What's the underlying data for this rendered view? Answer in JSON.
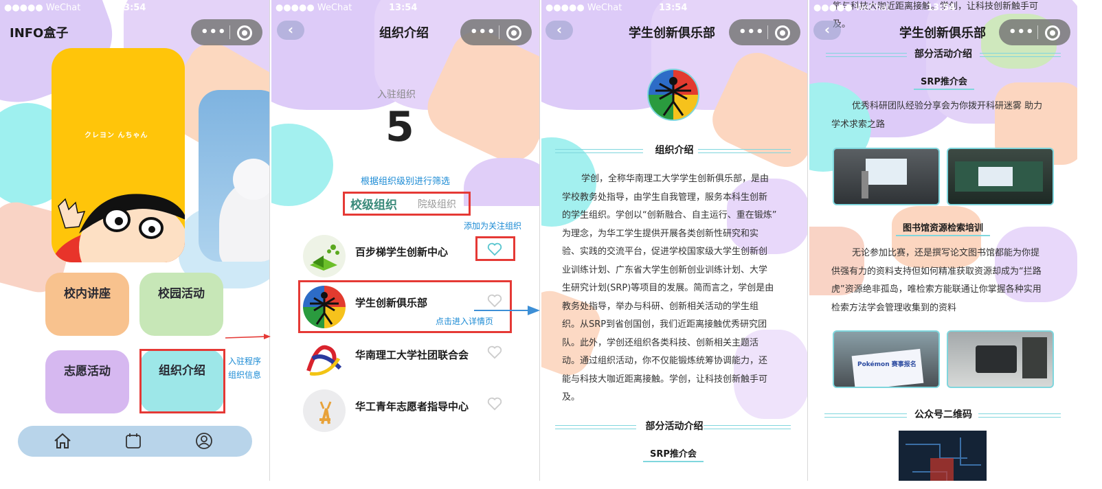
{
  "status": {
    "signal": "●●●●● WeChat",
    "time": "13:54"
  },
  "capsule": {
    "dots": "•••"
  },
  "screen1": {
    "title": "INFO盒子",
    "banner_text": "クレヨン  んちゃん",
    "tiles": [
      "校内讲座",
      "校园活动",
      "志愿活动",
      "组织介绍"
    ],
    "annotation": "入驻程序\n组织信息"
  },
  "screen2": {
    "title": "组织介绍",
    "count_label": "入驻组织",
    "count": "5",
    "filter_hint": "根据组织级别进行筛选",
    "tab_active": "校级组织",
    "tab_inactive": "院级组织",
    "follow_hint": "添加为关注组织",
    "detail_hint": "点击进入详情页",
    "orgs": [
      "百步梯学生创新中心",
      "学生创新俱乐部",
      "华南理工大学社团联合会",
      "华工青年志愿者指导中心"
    ]
  },
  "screen3": {
    "title": "学生创新俱乐部",
    "section_intro": "组织介绍",
    "intro_lines": [
      "学创，全称华南理工大学学生创新俱乐部，是由",
      "学校教务处指导，由学生自我管理，服务本科生创新",
      "的学生组织。学创以“创新融合、自主运行、重在锻炼”",
      "为理念，为华工学生提供开展各类创新性研究和实",
      "验、实践的交流平台，促进学校国家级大学生创新创",
      "业训练计划、广东省大学生创新创业训练计划、大学",
      "生研究计划(SRP)等项目的发展。简而言之，学创是由",
      "教务处指导，举办与科研、创新相关活动的学生组",
      "织。从SRP到省创国创，我们近距离接触优秀研究团",
      "队。此外，学创还组织各类科技、创新相关主题活",
      "动。通过组织活动，你不仅能锻炼统筹协调能力，还",
      "能与科技大咖近距离接触。学创，让科技创新触手可",
      "及。"
    ],
    "section_activities": "部分活动介绍",
    "activity1_title": "SRP推介会"
  },
  "screen4": {
    "title": "学生创新俱乐部",
    "top_line1": "能与科技大咖近距离接触。学创，让科技创新触手可",
    "top_line2": "及。",
    "section_activities": "部分活动介绍",
    "activity1_title": "SRP推介会",
    "activity1_desc1": "优秀科研团队经验分享会为你拨开科研迷雾 助力",
    "activity1_desc2": "学术求索之路",
    "activity2_title": "图书馆资源检索培训",
    "activity2_lines": [
      "无论参加比赛，还是撰写论文图书馆都能为你提",
      "供强有力的资料支持但如何精准获取资源却成为“拦路",
      "虎”资源绝非孤岛，唯检索方能联通让你掌握各种实用",
      "检索方法学会管理收集到的资料"
    ],
    "section_qr": "公众号二维码",
    "poster_text": "Pokémon 赛事报名"
  },
  "colors": {
    "accent_blue": "#1a8ad4",
    "red_annotation": "#e53935",
    "teal_line": "#7fd6dd"
  }
}
